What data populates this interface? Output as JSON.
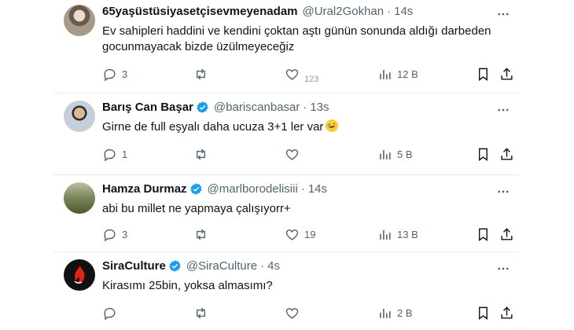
{
  "tweets": [
    {
      "name": "65yaşüstüsiyasetçisevmeyenadam",
      "handle": "@Ural2Gokhan",
      "dot": "·",
      "time": "14s",
      "verified": false,
      "text": "Ev sahipleri haddini ve kendini çoktan aştı günün sonunda aldığı darbeden gocunmayacak bizde üzülmeyeceğiz",
      "replies": "3",
      "retweets": "",
      "likes": "123",
      "views": "12 B"
    },
    {
      "name": "Barış Can Başar",
      "handle": "@bariscanbasar",
      "dot": "·",
      "time": "13s",
      "verified": true,
      "text": "Girne de full eşyalı daha ucuza 3+1 ler var",
      "emoji": "rolling-on-floor-laughing-emoji",
      "replies": "1",
      "retweets": "",
      "likes": "",
      "views": "5 B"
    },
    {
      "name": "Hamza Durmaz",
      "handle": "@marlborodelisiii",
      "dot": "·",
      "time": "14s",
      "verified": true,
      "text": "abi bu millet ne yapmaya çalışıyorr+",
      "replies": "3",
      "retweets": "",
      "likes": "19",
      "views": "13 B"
    },
    {
      "name": "SiraCulture",
      "handle": "@SiraCulture",
      "dot": "·",
      "time": "4s",
      "verified": true,
      "text": "Kirasımı 25bin, yoksa almasımı?",
      "replies": "",
      "retweets": "",
      "likes": "",
      "views": "2 B"
    }
  ],
  "colors": {
    "verified": "#1d9bf0",
    "muted": "#536471",
    "text": "#0f1419"
  },
  "icons": [
    "reply-icon",
    "retweet-icon",
    "like-icon",
    "views-icon",
    "bookmark-icon",
    "share-icon",
    "more-icon",
    "verified-badge-icon"
  ]
}
